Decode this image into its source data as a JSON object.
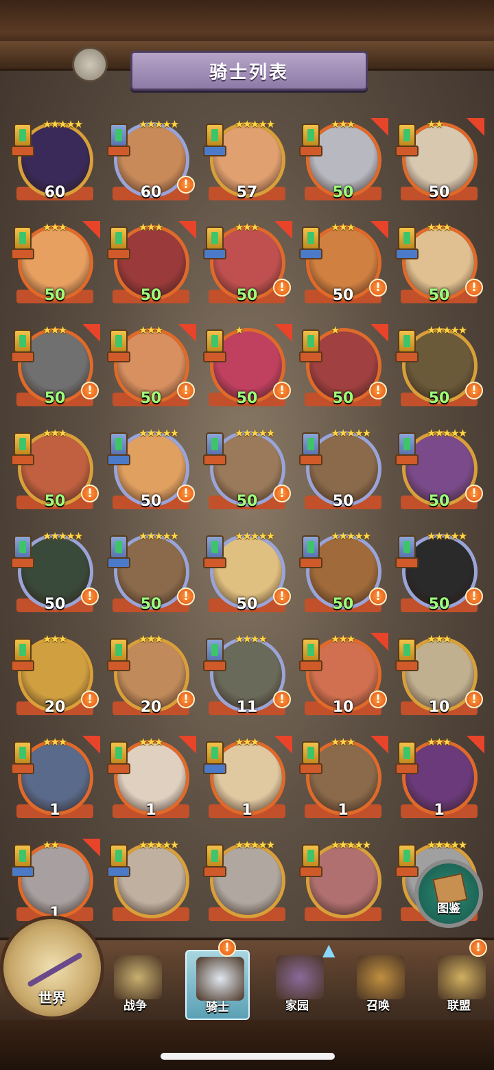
{
  "header": {
    "title": "骑士列表"
  },
  "knights": [
    {
      "level": "60",
      "stars": "★★★★★",
      "frame": "gold",
      "badge": "gold",
      "tag": "red",
      "flag": false,
      "alert": false,
      "level_color": "white",
      "face": "#3a2a5a"
    },
    {
      "level": "60",
      "stars": "★★★★★",
      "frame": "purple",
      "badge": "blue",
      "tag": "red",
      "flag": false,
      "alert": true,
      "level_color": "white",
      "face": "#c98a5a"
    },
    {
      "level": "57",
      "stars": "★★★★★",
      "frame": "gold",
      "badge": "gold",
      "tag": "blue",
      "flag": false,
      "alert": false,
      "level_color": "white",
      "face": "#e0a070"
    },
    {
      "level": "50",
      "stars": "★★★",
      "frame": "orange",
      "badge": "gold",
      "tag": "red",
      "flag": true,
      "alert": false,
      "level_color": "green",
      "face": "#b8b8c0"
    },
    {
      "level": "50",
      "stars": "★★",
      "frame": "orange",
      "badge": "gold",
      "tag": "red",
      "flag": true,
      "alert": false,
      "level_color": "white",
      "face": "#d8c8b0"
    },
    {
      "level": "50",
      "stars": "★★★",
      "frame": "orange",
      "badge": "gold",
      "tag": "red",
      "flag": true,
      "alert": false,
      "level_color": "green",
      "face": "#e8a060"
    },
    {
      "level": "50",
      "stars": "★★★",
      "frame": "orange",
      "badge": "gold",
      "tag": "red",
      "flag": true,
      "alert": false,
      "level_color": "green",
      "face": "#9a3a3a"
    },
    {
      "level": "50",
      "stars": "★★★",
      "frame": "orange",
      "badge": "gold",
      "tag": "blue",
      "flag": true,
      "alert": true,
      "level_color": "green",
      "face": "#c05050"
    },
    {
      "level": "50",
      "stars": "★★★",
      "frame": "orange",
      "badge": "gold",
      "tag": "blue",
      "flag": true,
      "alert": true,
      "level_color": "white",
      "face": "#d08040"
    },
    {
      "level": "50",
      "stars": "★★★",
      "frame": "orange",
      "badge": "gold",
      "tag": "blue",
      "flag": false,
      "alert": true,
      "level_color": "green",
      "face": "#e0c090"
    },
    {
      "level": "50",
      "stars": "★★★",
      "frame": "orange",
      "badge": "gold",
      "tag": "red",
      "flag": true,
      "alert": true,
      "level_color": "green",
      "face": "#707070"
    },
    {
      "level": "50",
      "stars": "★★★",
      "frame": "orange",
      "badge": "gold",
      "tag": "red",
      "flag": true,
      "alert": true,
      "level_color": "green",
      "face": "#d89060"
    },
    {
      "level": "50",
      "stars": "★",
      "frame": "orange",
      "badge": "gold",
      "tag": "red",
      "flag": true,
      "alert": true,
      "level_color": "green",
      "face": "#c04060"
    },
    {
      "level": "50",
      "stars": "★",
      "frame": "orange",
      "badge": "gold",
      "tag": "red",
      "flag": true,
      "alert": true,
      "level_color": "green",
      "face": "#a04040"
    },
    {
      "level": "50",
      "stars": "★★★★★",
      "frame": "gold",
      "badge": "gold",
      "tag": "red",
      "flag": false,
      "alert": true,
      "level_color": "green",
      "face": "#6a5a3a"
    },
    {
      "level": "50",
      "stars": "★★★",
      "frame": "gold",
      "badge": "gold",
      "tag": "red",
      "flag": false,
      "alert": true,
      "level_color": "green",
      "face": "#c06040"
    },
    {
      "level": "50",
      "stars": "★★★★★",
      "frame": "purple",
      "badge": "blue",
      "tag": "blue",
      "flag": false,
      "alert": true,
      "level_color": "white",
      "face": "#e0a060"
    },
    {
      "level": "50",
      "stars": "★★★★★",
      "frame": "purple",
      "badge": "blue",
      "tag": "red",
      "flag": false,
      "alert": true,
      "level_color": "green",
      "face": "#9a7a5a"
    },
    {
      "level": "50",
      "stars": "★★★★★",
      "frame": "purple",
      "badge": "blue",
      "tag": "red",
      "flag": false,
      "alert": false,
      "level_color": "white",
      "face": "#8a6a4a"
    },
    {
      "level": "50",
      "stars": "★★★★★",
      "frame": "gold",
      "badge": "blue",
      "tag": "red",
      "flag": false,
      "alert": true,
      "level_color": "green",
      "face": "#7a4a8a"
    },
    {
      "level": "50",
      "stars": "★★★★★",
      "frame": "purple",
      "badge": "blue",
      "tag": "red",
      "flag": false,
      "alert": true,
      "level_color": "white",
      "face": "#3a4a3a"
    },
    {
      "level": "50",
      "stars": "★★★★★",
      "frame": "purple",
      "badge": "blue",
      "tag": "blue",
      "flag": false,
      "alert": true,
      "level_color": "green",
      "face": "#8a6a4a"
    },
    {
      "level": "50",
      "stars": "★★★★★",
      "frame": "purple",
      "badge": "blue",
      "tag": "red",
      "flag": false,
      "alert": true,
      "level_color": "white",
      "face": "#e0c080"
    },
    {
      "level": "50",
      "stars": "★★★★★",
      "frame": "purple",
      "badge": "blue",
      "tag": "red",
      "flag": false,
      "alert": true,
      "level_color": "green",
      "face": "#a06a3a"
    },
    {
      "level": "50",
      "stars": "★★★★★",
      "frame": "purple",
      "badge": "blue",
      "tag": "red",
      "flag": false,
      "alert": true,
      "level_color": "green",
      "face": "#2a2a2a"
    },
    {
      "level": "20",
      "stars": "★★★",
      "frame": "gold",
      "badge": "gold",
      "tag": "red",
      "flag": false,
      "alert": true,
      "level_color": "white",
      "face": "#d0a040"
    },
    {
      "level": "20",
      "stars": "★★★",
      "frame": "gold",
      "badge": "gold",
      "tag": "red",
      "flag": false,
      "alert": true,
      "level_color": "white",
      "face": "#c08a5a"
    },
    {
      "level": "11",
      "stars": "★★★★",
      "frame": "purple",
      "badge": "blue",
      "tag": "red",
      "flag": false,
      "alert": true,
      "level_color": "white",
      "face": "#6a6a5a"
    },
    {
      "level": "10",
      "stars": "★★★",
      "frame": "orange",
      "badge": "gold",
      "tag": "red",
      "flag": true,
      "alert": true,
      "level_color": "white",
      "face": "#d07050"
    },
    {
      "level": "10",
      "stars": "★★★",
      "frame": "gold",
      "badge": "gold",
      "tag": "red",
      "flag": false,
      "alert": true,
      "level_color": "white",
      "face": "#c0b090"
    },
    {
      "level": "1",
      "stars": "★★★",
      "frame": "orange",
      "badge": "gold",
      "tag": "red",
      "flag": true,
      "alert": false,
      "level_color": "white",
      "face": "#5a6a8a"
    },
    {
      "level": "1",
      "stars": "★★★",
      "frame": "orange",
      "badge": "gold",
      "tag": "red",
      "flag": true,
      "alert": false,
      "level_color": "white",
      "face": "#e0d0c0"
    },
    {
      "level": "1",
      "stars": "★★★",
      "frame": "orange",
      "badge": "gold",
      "tag": "blue",
      "flag": true,
      "alert": false,
      "level_color": "white",
      "face": "#e0c8a0"
    },
    {
      "level": "1",
      "stars": "★★★",
      "frame": "orange",
      "badge": "gold",
      "tag": "red",
      "flag": true,
      "alert": false,
      "level_color": "white",
      "face": "#8a6a4a"
    },
    {
      "level": "1",
      "stars": "★★★",
      "frame": "orange",
      "badge": "gold",
      "tag": "red",
      "flag": true,
      "alert": false,
      "level_color": "white",
      "face": "#6a3a7a"
    },
    {
      "level": "1",
      "stars": "★★",
      "frame": "orange",
      "badge": "gold",
      "tag": "blue",
      "flag": true,
      "alert": false,
      "level_color": "white",
      "face": "#a8a0a0"
    },
    {
      "level": "",
      "stars": "★★★★★",
      "frame": "gold",
      "badge": "gold",
      "tag": "blue",
      "flag": false,
      "alert": false,
      "level_color": "white",
      "face": "#c0b0a0"
    },
    {
      "level": "",
      "stars": "★★★★★",
      "frame": "gold",
      "badge": "gold",
      "tag": "red",
      "flag": false,
      "alert": false,
      "level_color": "white",
      "face": "#b0a8a0"
    },
    {
      "level": "",
      "stars": "★★★★★",
      "frame": "gold",
      "badge": "gold",
      "tag": "red",
      "flag": false,
      "alert": false,
      "level_color": "white",
      "face": "#b07070"
    },
    {
      "level": "",
      "stars": "★★★★★",
      "frame": "gold",
      "badge": "gold",
      "tag": "red",
      "flag": false,
      "alert": false,
      "level_color": "white",
      "face": "#a0a0a0"
    }
  ],
  "codex": {
    "label": "图鉴"
  },
  "nav": {
    "world": "世界",
    "items": [
      {
        "label": "战争",
        "icon": "map-icon",
        "active": false,
        "alert": false
      },
      {
        "label": "骑士",
        "icon": "knight-icon",
        "active": true,
        "alert": true
      },
      {
        "label": "家园",
        "icon": "house-icon",
        "active": false,
        "alert": false
      },
      {
        "label": "召唤",
        "icon": "train-icon",
        "active": false,
        "alert": false
      },
      {
        "label": "联盟",
        "icon": "castle-icon",
        "active": false,
        "alert": true
      }
    ],
    "alert_mark": "!"
  },
  "colors": {
    "alert": "#e0541a",
    "level_green": "#9dff7a",
    "star": "#ffd64a"
  }
}
